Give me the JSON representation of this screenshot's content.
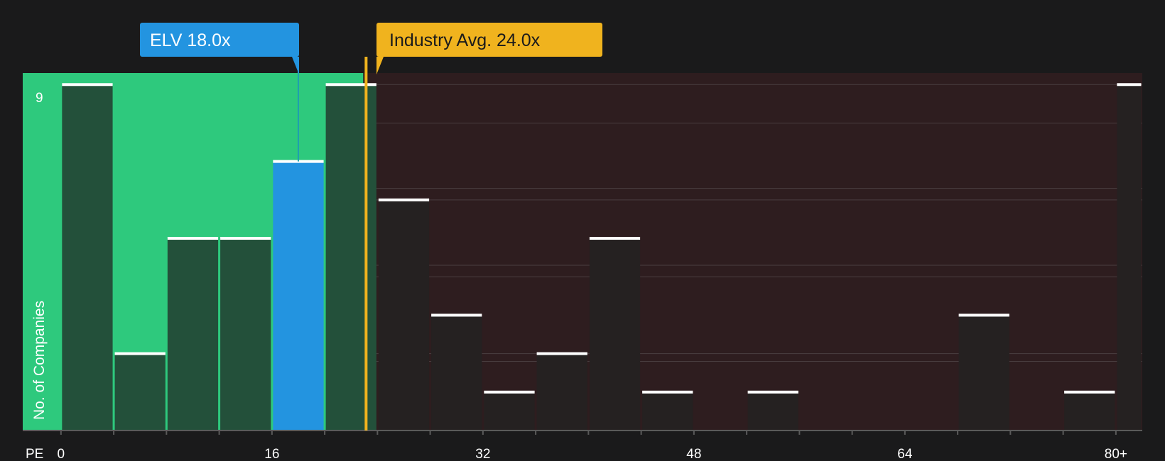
{
  "chart_data": {
    "type": "bar",
    "xlabel": "PE",
    "ylabel": "No. of Companies",
    "xlim": [
      -2.9,
      82
    ],
    "ylim": [
      0,
      9.3
    ],
    "x_ticks": [
      {
        "value": 0,
        "label": "0"
      },
      {
        "value": 16,
        "label": "16"
      },
      {
        "value": 32,
        "label": "32"
      },
      {
        "value": 48,
        "label": "48"
      },
      {
        "value": 64,
        "label": "64"
      },
      {
        "value": 80,
        "label": "80+"
      }
    ],
    "y_ticks": [
      {
        "value": 9,
        "label": "9"
      }
    ],
    "bin_width": 4,
    "bins": [
      {
        "start": 0,
        "end": 4,
        "count": 9
      },
      {
        "start": 4,
        "end": 8,
        "count": 2
      },
      {
        "start": 8,
        "end": 12,
        "count": 5
      },
      {
        "start": 12,
        "end": 16,
        "count": 5
      },
      {
        "start": 16,
        "end": 20,
        "count": 7,
        "highlight": true
      },
      {
        "start": 20,
        "end": 24,
        "count": 9
      },
      {
        "start": 24,
        "end": 28,
        "count": 6
      },
      {
        "start": 28,
        "end": 32,
        "count": 3
      },
      {
        "start": 32,
        "end": 36,
        "count": 1
      },
      {
        "start": 36,
        "end": 40,
        "count": 2
      },
      {
        "start": 40,
        "end": 44,
        "count": 5
      },
      {
        "start": 44,
        "end": 48,
        "count": 1
      },
      {
        "start": 48,
        "end": 52,
        "count": 0
      },
      {
        "start": 52,
        "end": 56,
        "count": 1
      },
      {
        "start": 56,
        "end": 60,
        "count": 0
      },
      {
        "start": 60,
        "end": 64,
        "count": 0
      },
      {
        "start": 64,
        "end": 68,
        "count": 0
      },
      {
        "start": 68,
        "end": 72,
        "count": 3
      },
      {
        "start": 72,
        "end": 76,
        "count": 0
      },
      {
        "start": 76,
        "end": 80,
        "count": 1
      },
      {
        "start": 80,
        "end": 82,
        "count": 9
      }
    ],
    "company": {
      "ticker": "ELV",
      "value": 18.0,
      "label": "ELV 18.0x",
      "color": "#2394e0"
    },
    "industry": {
      "value": 24.0,
      "label": "Industry Avg. 24.0x",
      "color": "#f0b31e"
    },
    "colors": {
      "background": "#1a1a1b",
      "below_region": "#2ec97d",
      "above_region": "#2e1d1f",
      "bar_below": "#23503a",
      "bar_above": "#252121",
      "bar_top": "#ffffff",
      "grid": "#4a3e40",
      "axis": "#5a5a5a"
    },
    "grid": true
  }
}
